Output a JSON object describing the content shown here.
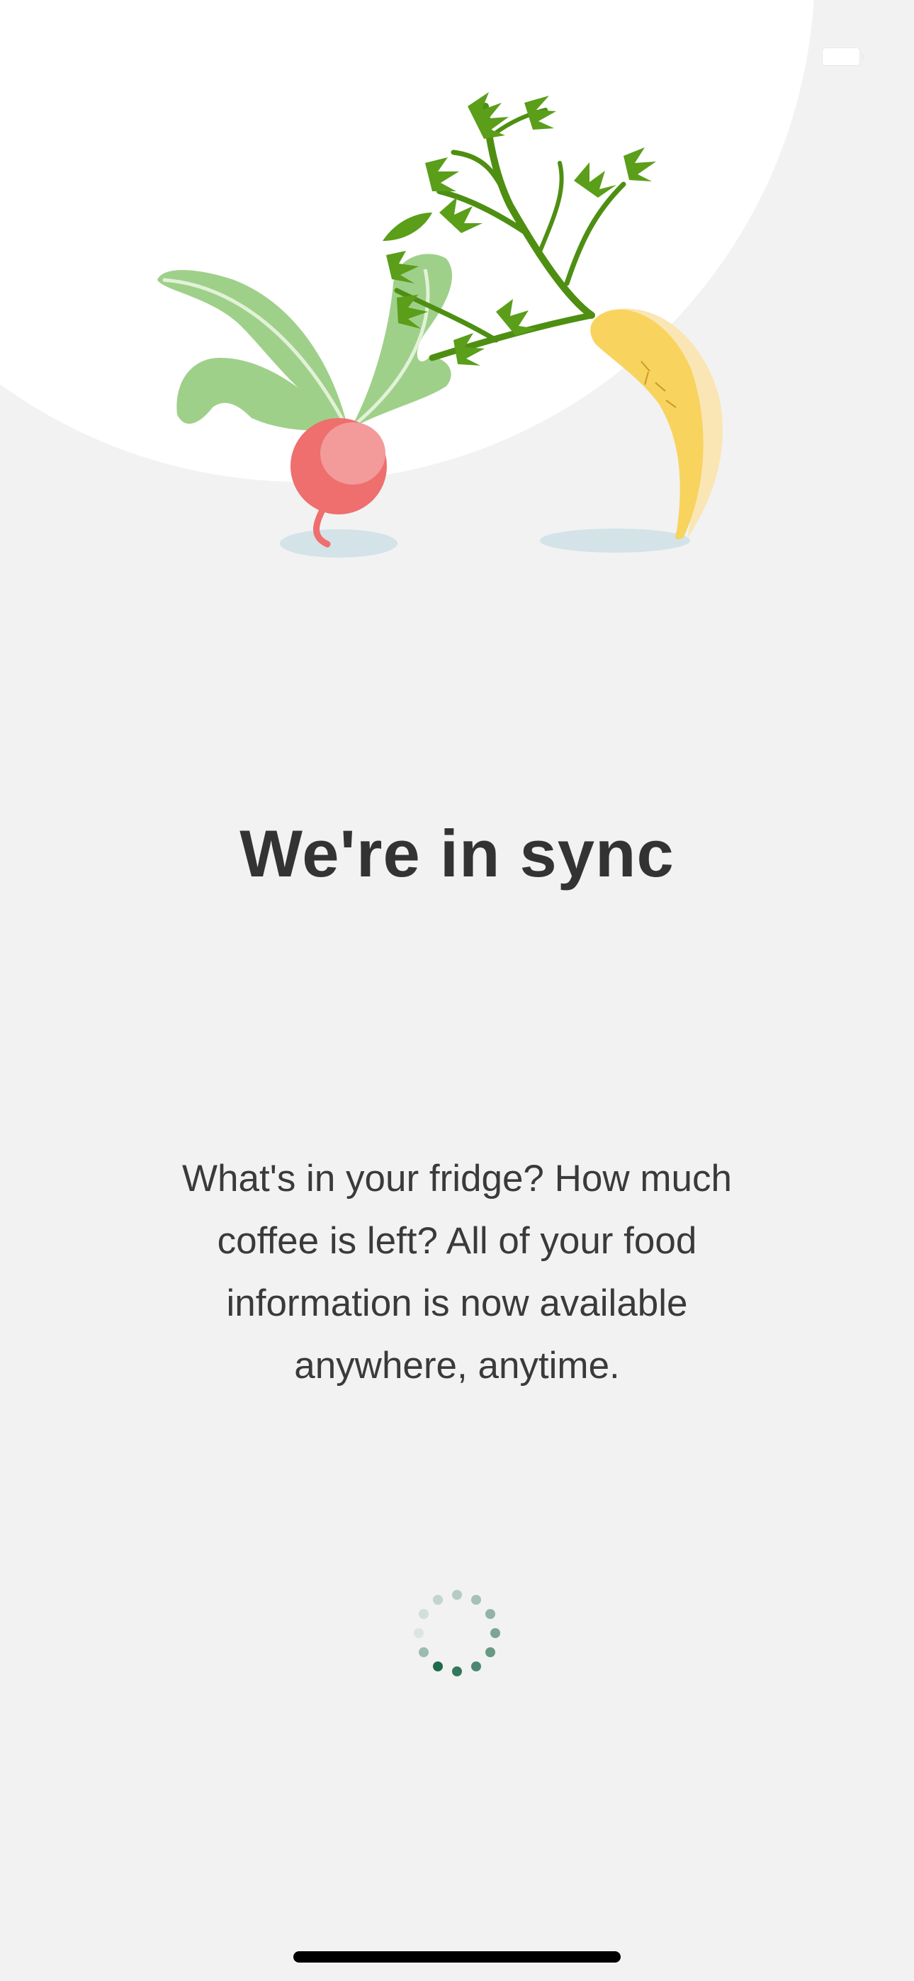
{
  "screen": {
    "title": "We're in sync",
    "body": "What's in your fridge? How much coffee is left? All of your food information is now available anywhere, anytime."
  },
  "illustration": {
    "items": [
      "radish",
      "carrot"
    ]
  },
  "icons": {
    "battery": "battery-icon",
    "spinner": "loading-spinner-icon"
  },
  "colors": {
    "background": "#f2f2f2",
    "circle": "#ffffff",
    "title_text": "#333333",
    "body_text": "#3a3a3a",
    "spinner_accent": "#1e6a4c",
    "radish": "#ef6e6e",
    "leaf": "#9fd08a",
    "carrot": "#f8d35e",
    "carrot_top": "#4e8f12"
  }
}
